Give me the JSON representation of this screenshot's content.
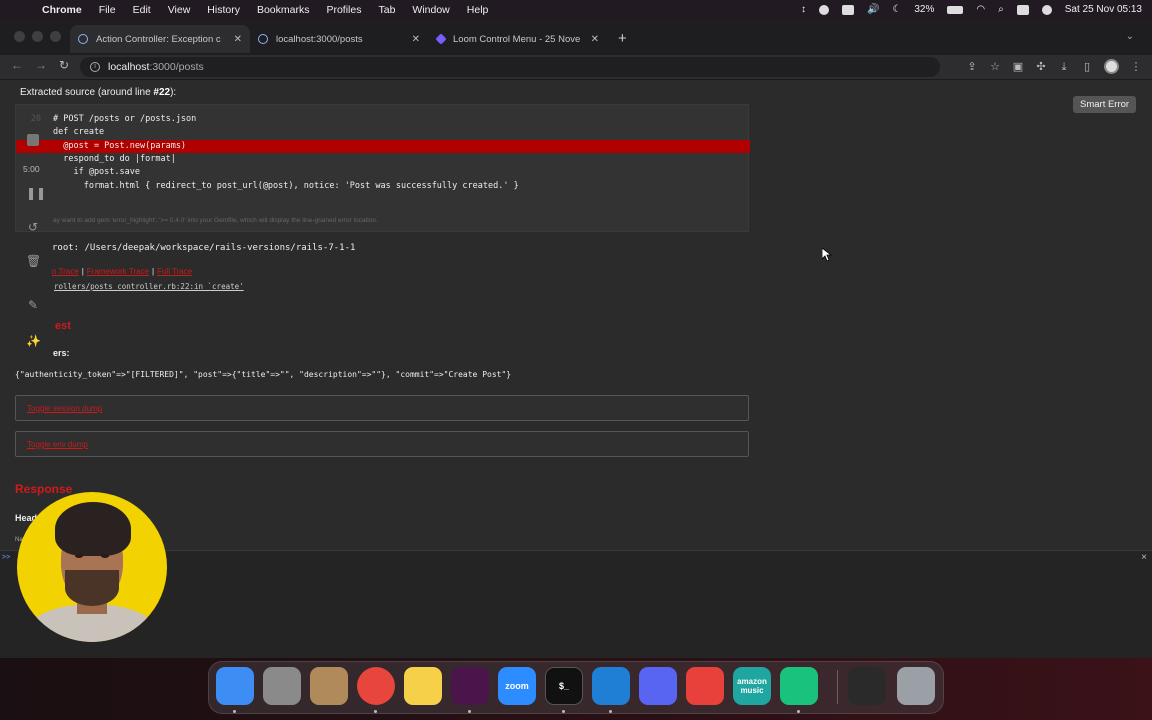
{
  "menubar": {
    "app": "Chrome",
    "items": [
      "File",
      "Edit",
      "View",
      "History",
      "Bookmarks",
      "Profiles",
      "Tab",
      "Window",
      "Help"
    ],
    "battery": "32%",
    "datetime": "Sat 25 Nov  05:13"
  },
  "tabs": [
    {
      "label": "Action Controller: Exception c",
      "icon": "globe-icon",
      "active": true
    },
    {
      "label": "localhost:3000/posts",
      "icon": "globe-icon",
      "active": false
    },
    {
      "label": "Loom Control Menu - 25 Nove",
      "icon": "loom-icon",
      "active": false
    }
  ],
  "address": {
    "domain": "localhost",
    "path": ":3000/posts"
  },
  "page": {
    "source_title_prefix": "Extracted source (around line ",
    "source_title_line": "#22",
    "source_title_suffix": "):",
    "code": [
      {
        "no": "20",
        "text": "# POST /posts or /posts.json",
        "hl": false
      },
      {
        "no": "",
        "text": "def create",
        "hl": false
      },
      {
        "no": "",
        "text": "  @post = Post.new(params)",
        "hl": true
      },
      {
        "no": "",
        "text": "  respond_to do |format|",
        "hl": false
      },
      {
        "no": "",
        "text": "    if @post.save",
        "hl": false
      },
      {
        "no": "",
        "text": "      format.html { redirect_to post_url(@post), notice: 'Post was successfully created.' }",
        "hl": false
      }
    ],
    "hint": "ay want to add gem 'error_highlight', '>= 0.4.0' into your Gemfile, which will display the line-grained error location.",
    "rails_root": "root: /Users/deepak/workspace/rails-versions/rails-7-1-1",
    "trace_links": [
      "n Trace",
      "Framework Trace",
      "Full Trace"
    ],
    "trace_line": "rollers/posts_controller.rb:22:in `create'",
    "request_title": "est",
    "params_label": "ers:",
    "params": "{\"authenticity_token\"=>\"[FILTERED]\", \"post\"=>{\"title\"=>\"\", \"description\"=>\"\"}, \"commit\"=>\"Create Post\"}",
    "toggle_session": "Toggle session dump",
    "toggle_env": "Toggle env dump",
    "response_title": "Response",
    "headers_label": "Head",
    "na": "Na",
    "smart_error": "Smart Error"
  },
  "loom": {
    "time": "5:00"
  },
  "console": {
    "prompt": ">>",
    "close": "×"
  },
  "dock": [
    {
      "name": "finder",
      "label": "",
      "color": "#3d8df5"
    },
    {
      "name": "launchpad",
      "label": "",
      "color": "#8a8a8a"
    },
    {
      "name": "contacts",
      "label": "",
      "color": "#b08a5a"
    },
    {
      "name": "chrome",
      "label": "",
      "color": "#e8453c"
    },
    {
      "name": "notes",
      "label": "",
      "color": "#f7d04a"
    },
    {
      "name": "slack",
      "label": "",
      "color": "#4a154b"
    },
    {
      "name": "zoom",
      "label": "zoom",
      "color": "#2d8cff"
    },
    {
      "name": "terminal",
      "label": "$_",
      "color": "#111111"
    },
    {
      "name": "vscode",
      "label": "",
      "color": "#1e7fd4"
    },
    {
      "name": "discord",
      "label": "",
      "color": "#5865f2"
    },
    {
      "name": "fantastical",
      "label": "",
      "color": "#e8403b"
    },
    {
      "name": "amazon-music",
      "label": "amazon music",
      "color": "#1fa6a0"
    },
    {
      "name": "chatgpt",
      "label": "",
      "color": "#19c37d"
    },
    {
      "name": "chrome-apps",
      "label": "",
      "color": "#2a2a2a"
    },
    {
      "name": "trash",
      "label": "",
      "color": "#9aa0a6"
    }
  ]
}
